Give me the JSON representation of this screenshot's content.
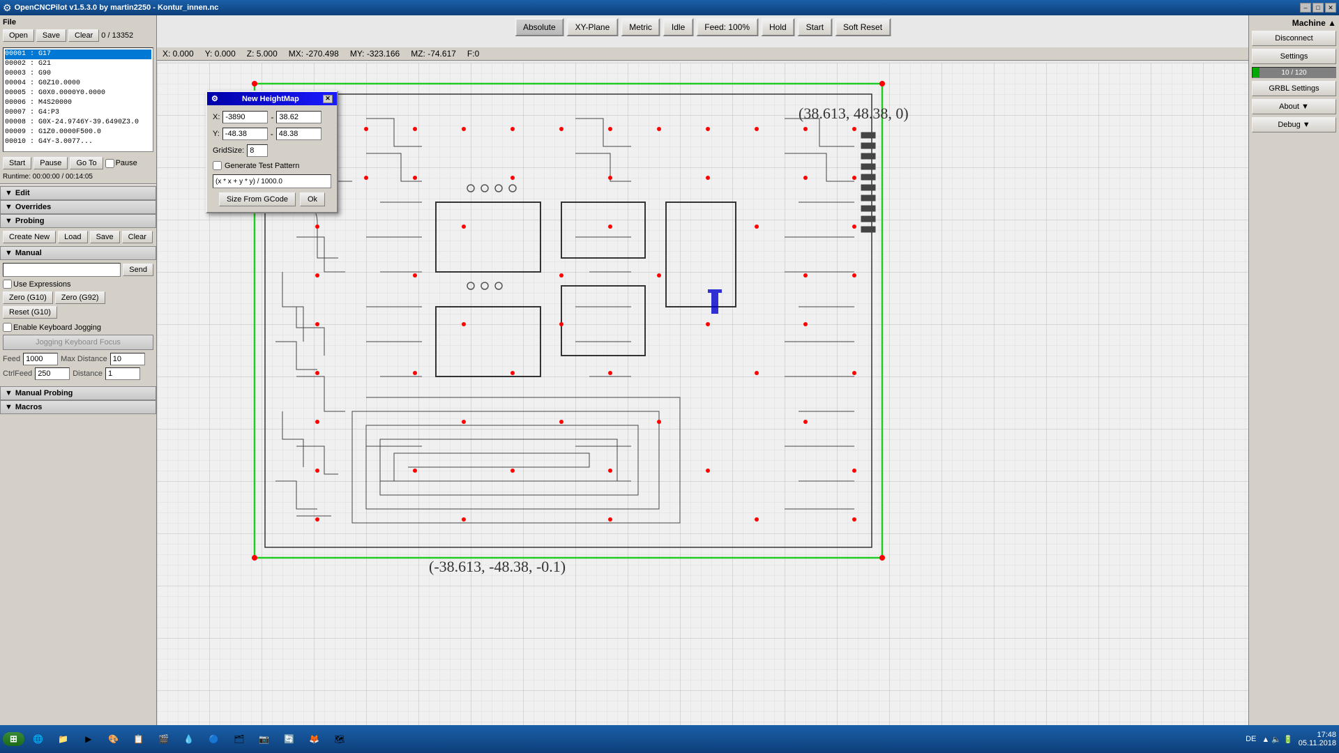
{
  "titleBar": {
    "text": "OpenCNCPilot v1.5.3.0 by martin2250 - Kontur_innen.nc",
    "minBtn": "–",
    "maxBtn": "□",
    "closeBtn": "✕"
  },
  "toolbar": {
    "buttons": [
      "Absolute",
      "XY-Plane",
      "Metric",
      "Idle",
      "Feed: 100%",
      "Hold",
      "Start",
      "Soft Reset"
    ]
  },
  "coords": {
    "x": "X: 0.000",
    "y": "Y: 0.000",
    "z": "Z: 5.000",
    "mx": "MX: -270.498",
    "my": "MY: -323.166",
    "mz": "MZ: -74.617",
    "f": "F:0"
  },
  "file": {
    "sectionLabel": "File",
    "openBtn": "Open",
    "saveBtn": "Save",
    "clearBtn": "Clear",
    "count": "0 / 13352"
  },
  "codeLines": [
    "00001 : G17",
    "00002 : G21",
    "00003 : G90",
    "00004 : G0Z10.0000",
    "00005 : G0X0.0000Y0.0000",
    "00006 : M4S20000",
    "00007 : G4:P3",
    "00008 : G0X-24.9746Y-39.6490Z3.0",
    "00009 : G1Z0.0000F500.0",
    "00010 : G4Y-3.0077..."
  ],
  "controls": {
    "startBtn": "Start",
    "pauseBtn": "Pause",
    "goToBtn": "Go To",
    "pauseCheckLabel": "Pause",
    "runtime": "Runtime: 00:00:00 / 00:14:05"
  },
  "editSection": "Edit",
  "overridesSection": "Overrides",
  "probing": {
    "sectionLabel": "Probing",
    "createNewBtn": "Create New",
    "loadBtn": "Load",
    "saveBtn": "Save",
    "clearBtn": "Clear"
  },
  "manual": {
    "sectionLabel": "Manual",
    "sendBtn": "Send",
    "useExpressionsLabel": "Use Expressions",
    "zeroG10Btn": "Zero (G10)",
    "zeroG92Btn": "Zero (G92)",
    "resetG10Btn": "Reset (G10)",
    "enableKbJoggingLabel": "Enable Keyboard Jogging",
    "joggingFocusBtn": "Jogging Keyboard Focus",
    "feedLabel": "Feed",
    "feedValue": "1000",
    "maxDistLabel": "Max Distance",
    "maxDistValue": "10",
    "ctrlFeedLabel": "CtrlFeed",
    "ctrlFeedValue": "250",
    "distLabel": "Distance",
    "distValue": "1"
  },
  "manualProbing": {
    "sectionLabel": "Manual Probing"
  },
  "macros": {
    "sectionLabel": "Macros"
  },
  "rightPanel": {
    "machineLabel": "Machine ▲",
    "disconnectBtn": "Disconnect",
    "settingsBtn": "Settings",
    "progress": "10 / 120",
    "progressPercent": 8,
    "grblSettingsBtn": "GRBL Settings",
    "aboutBtn": "About ▼",
    "debugBtn": "Debug ▼"
  },
  "dialog": {
    "title": "New HeightMap",
    "xLabel": "X:",
    "xMin": "-3890",
    "xMax": "38.62",
    "yLabel": "Y:",
    "yMin": "-48.38",
    "yMax": "48.38",
    "gridSizeLabel": "GridSize:",
    "gridSizeValue": "8",
    "generateTestLabel": "Generate Test Pattern",
    "formula": "(x * x + y * y) / 1000.0",
    "sizeFromGCodeBtn": "Size From GCode",
    "okBtn": "Ok"
  },
  "annotations": {
    "topRight": "(38.613, 48.38, 0)",
    "bottomLeft": "(-38.613, -48.38, -0.1)"
  },
  "taskbar": {
    "startLabel": "Start",
    "icons": [
      "🪟",
      "🌐",
      "📁",
      "▶",
      "🎨",
      "📋",
      "🎬",
      "💧",
      "🖼",
      "🔄",
      "🦊",
      "🖼",
      "🦁"
    ],
    "language": "DE",
    "time": "17:48",
    "date": "05.11.2018"
  }
}
